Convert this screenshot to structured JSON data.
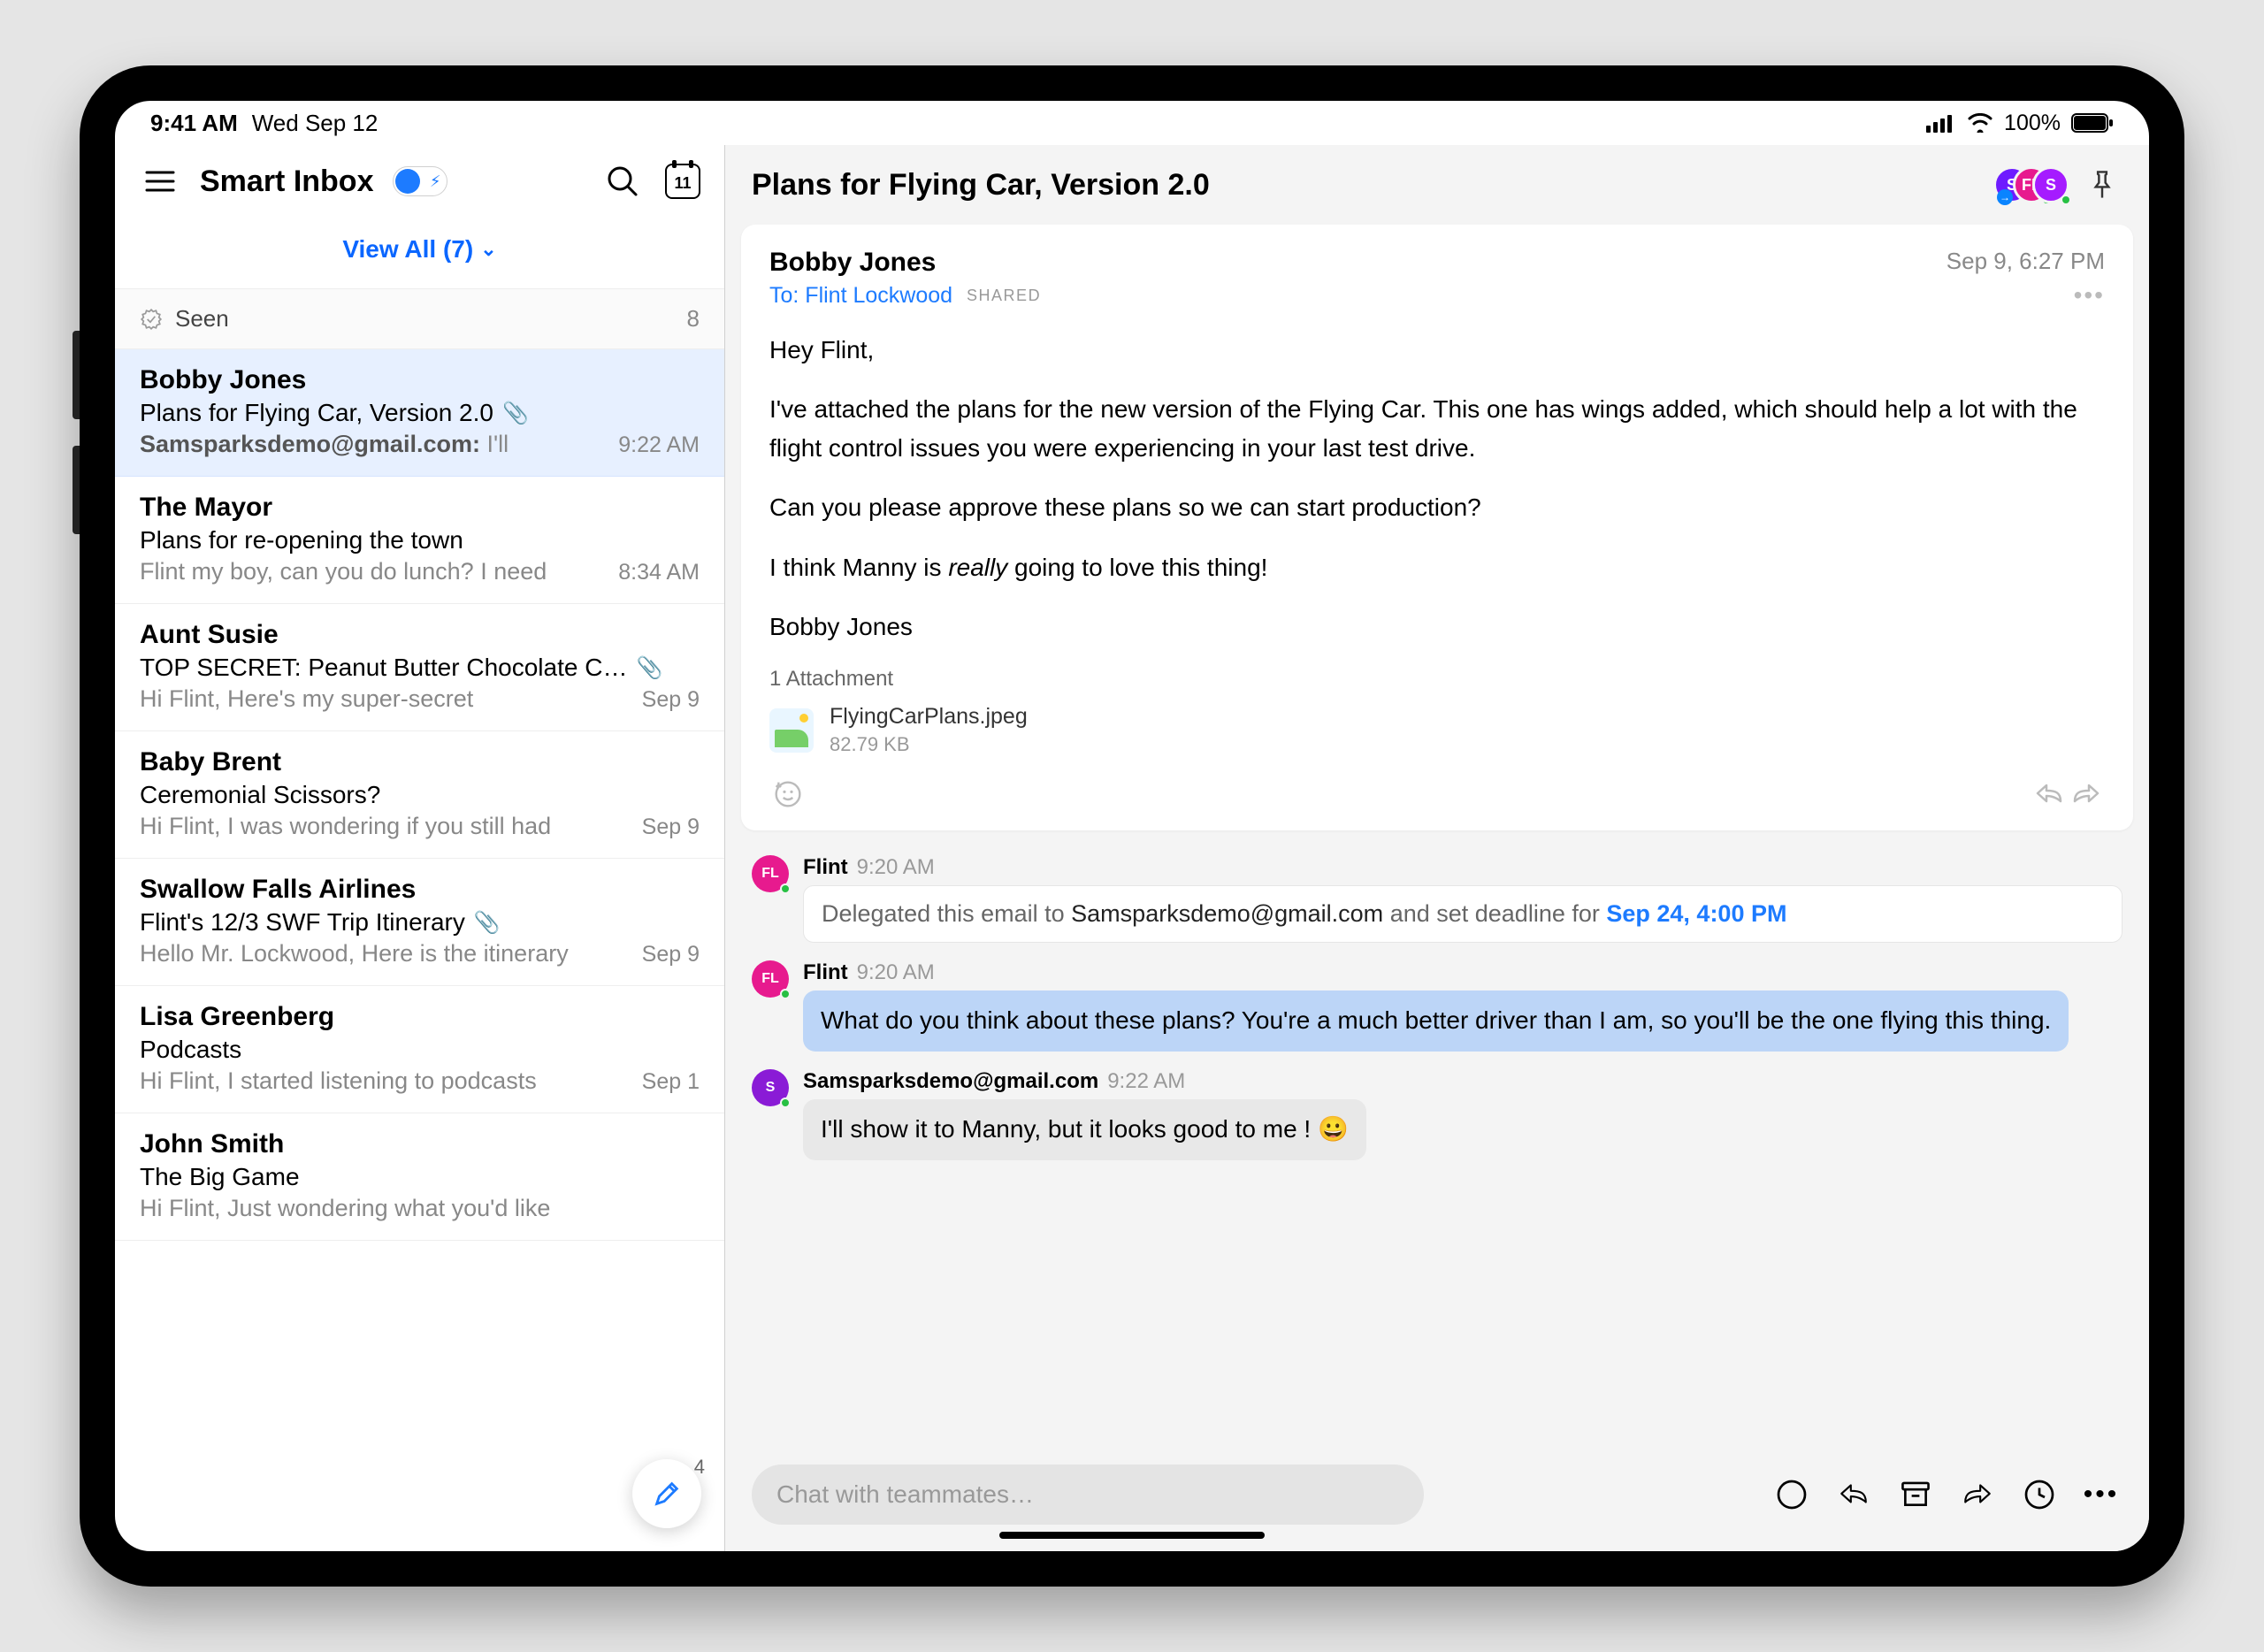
{
  "status_bar": {
    "time": "9:41 AM",
    "date": "Wed Sep 12",
    "battery": "100%"
  },
  "sidebar": {
    "title": "Smart Inbox",
    "calendar_day": "11",
    "view_all": "View All (7)",
    "section": {
      "label": "Seen",
      "count": "8"
    },
    "items": [
      {
        "sender": "Bobby Jones",
        "subject": "Plans for Flying Car, Version 2.0",
        "has_attachment": true,
        "preview_addr": "Samsparksdemo@gmail.com:",
        "preview_rest": " I'll",
        "time": "9:22 AM",
        "selected": true
      },
      {
        "sender": "The Mayor",
        "subject": "Plans for re-opening the town",
        "has_attachment": false,
        "preview": "Flint my boy, can you do lunch? I need",
        "time": "8:34 AM"
      },
      {
        "sender": "Aunt Susie",
        "subject": "TOP SECRET: Peanut Butter Chocolate C…",
        "has_attachment": true,
        "preview": "Hi Flint, Here's my super-secret",
        "time": "Sep 9"
      },
      {
        "sender": "Baby Brent",
        "subject": "Ceremonial Scissors?",
        "has_attachment": false,
        "preview": "Hi Flint, I was wondering if you still had",
        "time": "Sep 9"
      },
      {
        "sender": "Swallow Falls Airlines",
        "subject": "Flint's 12/3 SWF Trip Itinerary",
        "has_attachment": true,
        "preview": "Hello Mr. Lockwood, Here is the itinerary",
        "time": "Sep 9"
      },
      {
        "sender": "Lisa Greenberg",
        "subject": "Podcasts",
        "has_attachment": false,
        "preview": "Hi Flint, I started listening to podcasts",
        "time": "Sep 1"
      },
      {
        "sender": "John Smith",
        "subject": "The Big Game",
        "has_attachment": false,
        "preview": "Hi Flint, Just wondering what you'd like",
        "time": ""
      }
    ],
    "fab_badge": "4"
  },
  "thread": {
    "title": "Plans for Flying Car, Version 2.0",
    "avatars": [
      "S",
      "FL",
      "S"
    ]
  },
  "email": {
    "from": "Bobby Jones",
    "to_label": "To: ",
    "to_name": "Flint Lockwood",
    "shared": "SHARED",
    "timestamp": "Sep 9, 6:27 PM",
    "body_p1": "Hey Flint,",
    "body_p2": "I've attached the plans for the new version of the Flying Car. This one has wings added, which should help a lot with the flight control issues you were experiencing in your last test drive.",
    "body_p3": "Can you please approve these plans so we can start production?",
    "body_p4_pre": "I think Manny is ",
    "body_p4_em": "really",
    "body_p4_post": " going to love this thing!",
    "body_p5": "Bobby Jones",
    "attach_label": "1 Attachment",
    "attachment": {
      "name": "FlyingCarPlans.jpeg",
      "size": "82.79 KB"
    }
  },
  "chat": [
    {
      "author": "Flint",
      "time": "9:20 AM",
      "avatar": "FL",
      "avatar_color": "#e71a8e",
      "type": "delegate",
      "text_pre": "Delegated this email to ",
      "delegate_to": "Samsparksdemo@gmail.com",
      "text_mid": " and set deadline for ",
      "deadline": "Sep 24, 4:00 PM"
    },
    {
      "author": "Flint",
      "time": "9:20 AM",
      "avatar": "FL",
      "avatar_color": "#e71a8e",
      "type": "blue",
      "text": "What do you think about these plans? You're a much better driver than I am, so you'll be the one flying this thing."
    },
    {
      "author": "Samsparksdemo@gmail.com",
      "time": "9:22 AM",
      "avatar": "S",
      "avatar_color": "#8a1bd6",
      "type": "gray",
      "text": "I'll show it to Manny, but it looks good to me ! 😀"
    }
  ],
  "compose": {
    "placeholder": "Chat with teammates…"
  }
}
